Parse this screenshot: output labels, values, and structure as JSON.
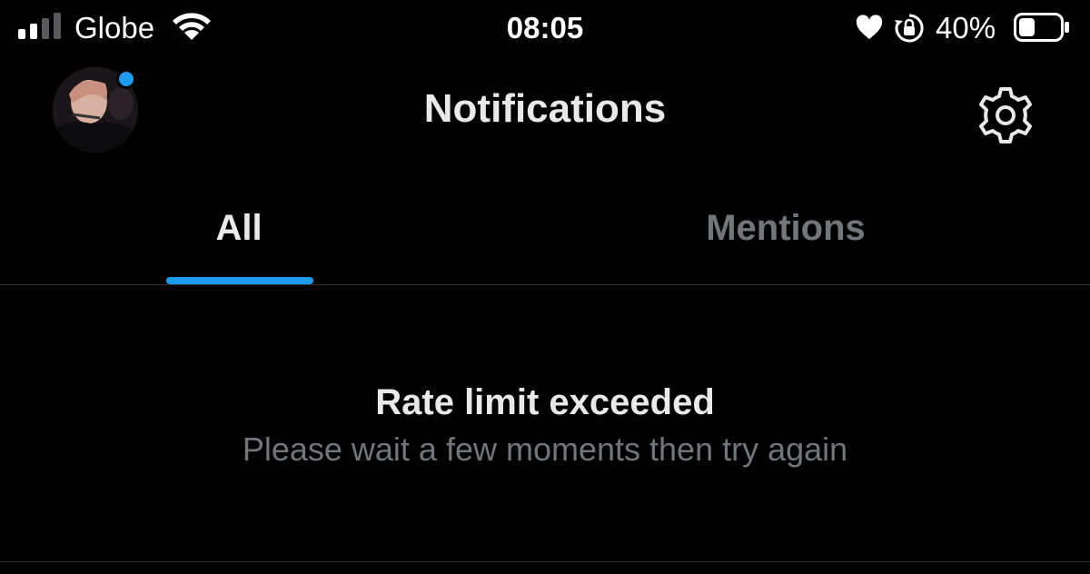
{
  "status_bar": {
    "carrier": "Globe",
    "time": "08:05",
    "battery_percent": "40%",
    "signal_bars_active": 2,
    "signal_bars_total": 4,
    "battery_level": 0.4,
    "icons": [
      "signal-icon",
      "wifi-icon",
      "heart-icon",
      "rotation-lock-icon",
      "battery-icon"
    ]
  },
  "header": {
    "title": "Notifications",
    "avatar_has_badge": true,
    "settings_icon": "gear-icon"
  },
  "tabs": [
    {
      "label": "All",
      "active": true
    },
    {
      "label": "Mentions",
      "active": false
    }
  ],
  "message": {
    "title": "Rate limit exceeded",
    "subtitle": "Please wait a few moments then try again"
  },
  "colors": {
    "background": "#000000",
    "accent": "#1d9bf0",
    "primary_text": "#e7e9ea",
    "secondary_text": "#71767b",
    "divider": "#2f3336"
  }
}
